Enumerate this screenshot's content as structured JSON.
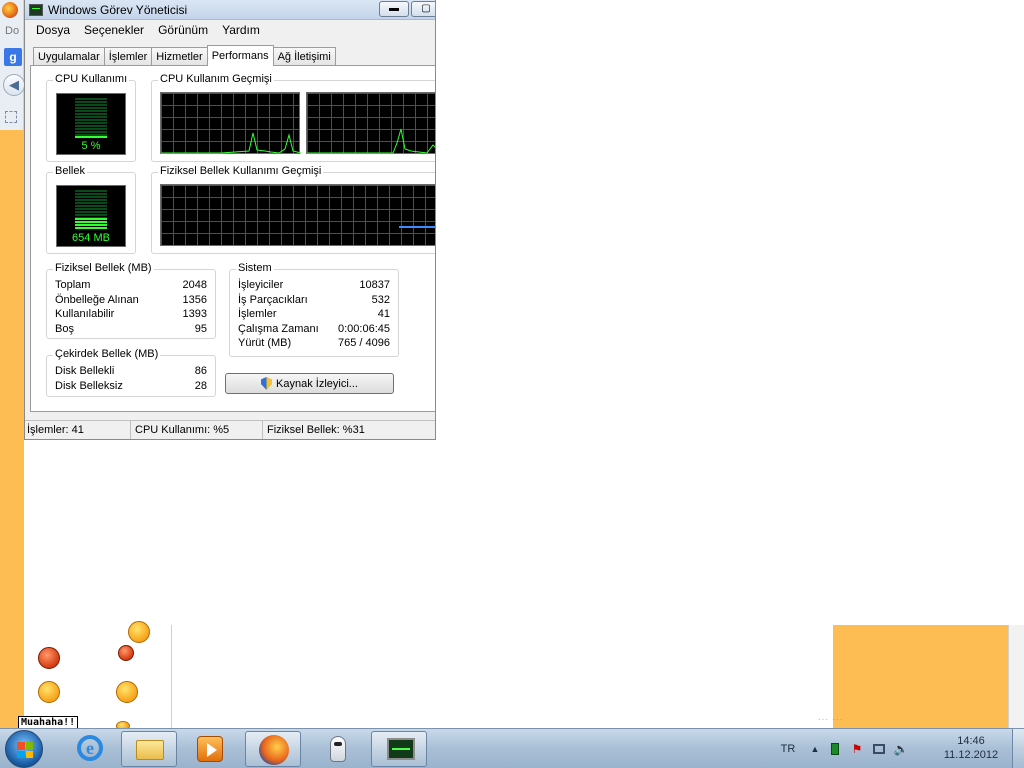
{
  "window": {
    "title": "Windows Görev Yöneticisi",
    "minimize_glyph": "▬",
    "maximize_glyph": "▢"
  },
  "menu": [
    "Dosya",
    "Seçenekler",
    "Görünüm",
    "Yardım"
  ],
  "tabs": [
    {
      "label": "Uygulamalar",
      "active": false
    },
    {
      "label": "İşlemler",
      "active": false
    },
    {
      "label": "Hizmetler",
      "active": false
    },
    {
      "label": "Performans",
      "active": true
    },
    {
      "label": "Ağ İletişimi",
      "active": false
    }
  ],
  "performance": {
    "cpu_usage": {
      "label": "CPU Kullanımı",
      "value_text": "5 %",
      "percent": 5
    },
    "cpu_history": {
      "label": "CPU Kullanım Geçmişi"
    },
    "memory": {
      "label": "Bellek",
      "value_text": "654 MB",
      "percent": 31
    },
    "memory_history": {
      "label": "Fiziksel Bellek Kullanımı Geçmişi"
    },
    "physical_memory": {
      "label": "Fiziksel Bellek (MB)",
      "rows": [
        {
          "name": "Toplam",
          "value": "2048"
        },
        {
          "name": "Önbelleğe Alınan",
          "value": "1356"
        },
        {
          "name": "Kullanılabilir",
          "value": "1393"
        },
        {
          "name": "Boş",
          "value": "95"
        }
      ]
    },
    "kernel_memory": {
      "label": "Çekirdek Bellek (MB)",
      "rows": [
        {
          "name": "Disk Bellekli",
          "value": "86"
        },
        {
          "name": "Disk Belleksiz",
          "value": "28"
        }
      ]
    },
    "system": {
      "label": "Sistem",
      "rows": [
        {
          "name": "İşleyiciler",
          "value": "10837"
        },
        {
          "name": "İş Parçacıkları",
          "value": "532"
        },
        {
          "name": "İşlemler",
          "value": "41"
        },
        {
          "name": "Çalışma Zamanı",
          "value": "0:00:06:45"
        },
        {
          "name": "Yürüt (MB)",
          "value": "765 / 4096"
        }
      ]
    },
    "resource_monitor_button": "Kaynak İzleyici..."
  },
  "statusbar": {
    "processes": "İşlemler: 41",
    "cpu": "CPU Kullanımı: %5",
    "memory": "Fiziksel Bellek: %31"
  },
  "background": {
    "browser_menu_fragment": "Do",
    "google_letter": "g",
    "chat_text": "Muahaha!!"
  },
  "taskbar": {
    "apps": [
      "Internet Explorer",
      "Windows Explorer",
      "Windows Media Player",
      "Firefox",
      "Robot",
      "Görev Yöneticisi"
    ],
    "language": "TR",
    "time": "14:46",
    "date": "11.12.2012"
  }
}
